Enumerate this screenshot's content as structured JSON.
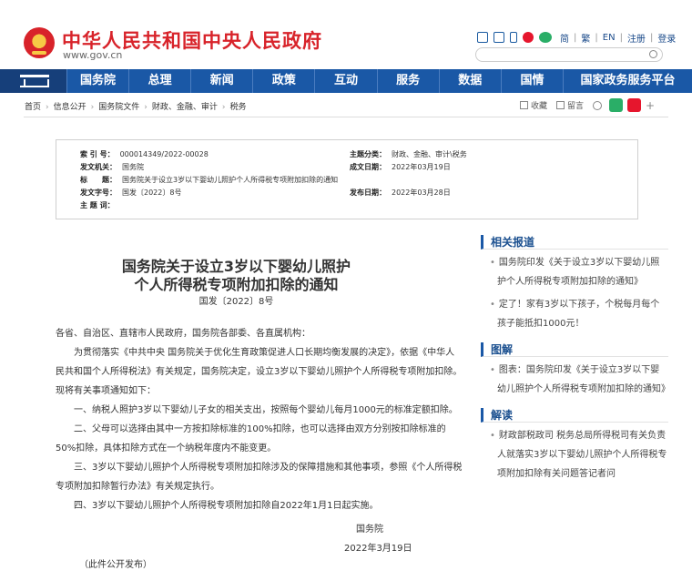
{
  "header": {
    "site_title": "中华人民共和国中央人民政府",
    "site_url": "www.gov.cn",
    "lang_links": [
      "简",
      "繁",
      "EN",
      "注册",
      "登录"
    ],
    "search_placeholder": ""
  },
  "nav": {
    "items": [
      "国务院",
      "总理",
      "新闻",
      "政策",
      "互动",
      "服务",
      "数据",
      "国情",
      "国家政务服务平台"
    ]
  },
  "breadcrumb": [
    "首页",
    "信息公开",
    "国务院文件",
    "财政、金融、审计",
    "税务"
  ],
  "tools": {
    "favorite": "收藏",
    "comment": "留言",
    "plus": "+"
  },
  "info": {
    "index_label": "索 引 号：",
    "index_value": "000014349/2022-00028",
    "topic_label": "主题分类：",
    "topic_value": "财政、金融、审计\\税务",
    "issuer_label": "发文机关：",
    "issuer_value": "国务院",
    "created_label": "成文日期：",
    "created_value": "2022年03月19日",
    "title_label": "标　　题：",
    "title_value": "国务院关于设立3岁以下婴幼儿照护个人所得税专项附加扣除的通知",
    "docno_label": "发文字号：",
    "docno_value": "国发〔2022〕8号",
    "published_label": "发布日期：",
    "published_value": "2022年03月28日",
    "subject_label": "主 题 词：",
    "subject_value": ""
  },
  "article": {
    "title_line1": "国务院关于设立3岁以下婴幼儿照护",
    "title_line2": "个人所得税专项附加扣除的通知",
    "doc_number": "国发〔2022〕8号",
    "salutation": "各省、自治区、直辖市人民政府，国务院各部委、各直属机构：",
    "paragraphs": [
      "为贯彻落实《中共中央 国务院关于优化生育政策促进人口长期均衡发展的决定》，依据《中华人民共和国个人所得税法》有关规定，国务院决定，设立3岁以下婴幼儿照护个人所得税专项附加扣除。现将有关事项通知如下：",
      "一、纳税人照护3岁以下婴幼儿子女的相关支出，按照每个婴幼儿每月1000元的标准定额扣除。",
      "二、父母可以选择由其中一方按扣除标准的100%扣除，也可以选择由双方分别按扣除标准的50%扣除，具体扣除方式在一个纳税年度内不能变更。",
      "三、3岁以下婴幼儿照护个人所得税专项附加扣除涉及的保障措施和其他事项，参照《个人所得税专项附加扣除暂行办法》有关规定执行。",
      "四、3岁以下婴幼儿照护个人所得税专项附加扣除自2022年1月1日起实施。"
    ],
    "signature": "国务院",
    "date": "2022年3月19日",
    "footnote": "（此件公开发布）"
  },
  "sidebar": {
    "sections": [
      {
        "heading": "相关报道",
        "items": [
          "国务院印发《关于设立3岁以下婴幼儿照护个人所得税专项附加扣除的通知》",
          "定了！家有3岁以下孩子，个税每月每个孩子能抵扣1000元！"
        ]
      },
      {
        "heading": "图解",
        "items": [
          "图表：国务院印发《关于设立3岁以下婴幼儿照护个人所得税专项附加扣除的通知》"
        ]
      },
      {
        "heading": "解读",
        "items": [
          "财政部税政司 税务总局所得税司有关负责人就落实3岁以下婴幼儿照护个人所得税专项附加扣除有关问题答记者问"
        ]
      }
    ]
  },
  "colors": {
    "brand_red": "#d8232a",
    "nav_blue": "#1a58a6",
    "link_blue": "#1a4f8f"
  },
  "icons": [
    "national-emblem-icon",
    "mail-icon",
    "rss-icon",
    "phone-icon",
    "weibo-icon",
    "wechat-icon",
    "search-icon",
    "gate-icon",
    "share-icon"
  ]
}
